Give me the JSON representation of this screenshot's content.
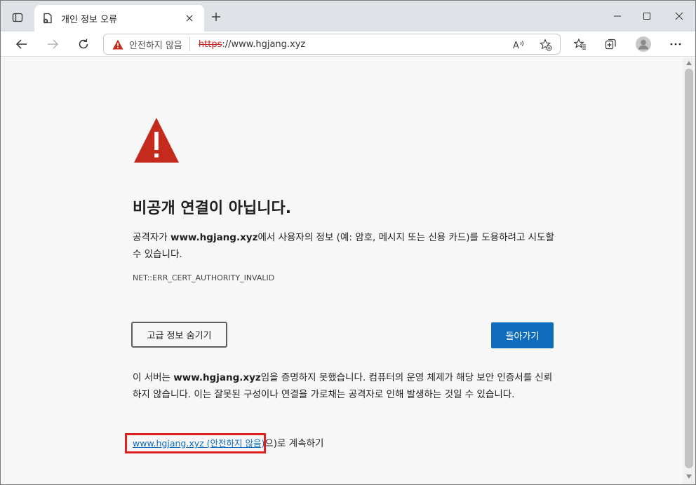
{
  "tab": {
    "title": "개인 정보 오류"
  },
  "address": {
    "security_label": "안전하지 않음",
    "url_scheme": "https",
    "url_rest": "://www.hgjang.xyz"
  },
  "page": {
    "heading": "비공개 연결이 아닙니다.",
    "desc_prefix": "공격자가 ",
    "desc_host": "www.hgjang.xyz",
    "desc_suffix": "에서 사용자의 정보 (예: 암호, 메시지 또는 신용 카드)를 도용하려고 시도할 수 있습니다.",
    "error_code": "NET::ERR_CERT_AUTHORITY_INVALID",
    "advanced_button": "고급 정보 숨기기",
    "back_button": "돌아가기",
    "detail_prefix": "이 서버는 ",
    "detail_host": "www.hgjang.xyz",
    "detail_suffix": "임을 증명하지 못했습니다. 컴퓨터의 운영 체제가 해당 보안 인증서를 신뢰하지 않습니다. 이는 잘못된 구성이나 연결을 가로채는 공격자로 인해 발생하는 것일 수 있습니다.",
    "proceed_link": "www.hgjang.xyz (안전하지 않음)",
    "proceed_suffix": "으)로 계속하기"
  },
  "colors": {
    "warning_red": "#c42b1c",
    "link_blue": "#0f6cbd",
    "highlight_red": "#e02020"
  }
}
